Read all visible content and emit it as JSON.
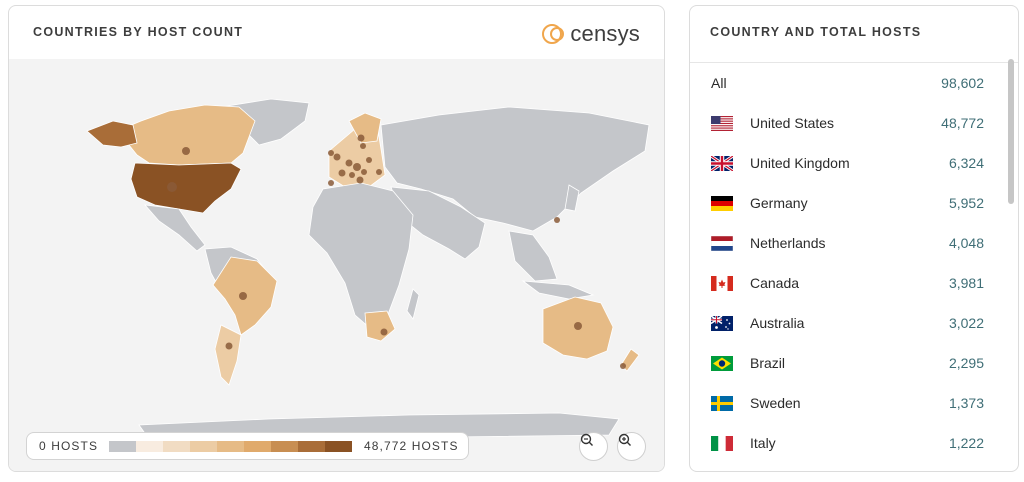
{
  "map_panel": {
    "title": "COUNTRIES BY HOST COUNT",
    "brand": "censys",
    "legend": {
      "min_label": "0 HOSTS",
      "max_label": "48,772 HOSTS",
      "colors": [
        "#c4c6ca",
        "#f8ece0",
        "#f1dcc3",
        "#ecccA4",
        "#e6bb86",
        "#e0aa6c",
        "#c88e52",
        "#a96d38",
        "#8a5224"
      ]
    },
    "zoom_out_icon": "zoom-out-icon",
    "zoom_in_icon": "zoom-in-icon"
  },
  "list_panel": {
    "title": "COUNTRY AND TOTAL HOSTS",
    "rows": [
      {
        "name": "All",
        "count": "98,602",
        "flag": ""
      },
      {
        "name": "United States",
        "count": "48,772",
        "flag": "us-flag-icon"
      },
      {
        "name": "United Kingdom",
        "count": "6,324",
        "flag": "uk-flag-icon"
      },
      {
        "name": "Germany",
        "count": "5,952",
        "flag": "de-flag-icon"
      },
      {
        "name": "Netherlands",
        "count": "4,048",
        "flag": "nl-flag-icon"
      },
      {
        "name": "Canada",
        "count": "3,981",
        "flag": "ca-flag-icon"
      },
      {
        "name": "Australia",
        "count": "3,022",
        "flag": "au-flag-icon"
      },
      {
        "name": "Brazil",
        "count": "2,295",
        "flag": "br-flag-icon"
      },
      {
        "name": "Sweden",
        "count": "1,373",
        "flag": "se-flag-icon"
      },
      {
        "name": "Italy",
        "count": "1,222",
        "flag": "it-flag-icon"
      }
    ]
  },
  "colors": {
    "land_default": "#c4c6ca",
    "us": "#8a5224",
    "canada": "#e6bb86",
    "alaska": "#a96d38",
    "brazil": "#e6bb86",
    "australia": "#e6bb86",
    "argentina": "#eccca4",
    "south_africa": "#e6bb86",
    "europe": "#eccca4",
    "marker": "#8a5a38",
    "count_text": "#3f6e76"
  }
}
